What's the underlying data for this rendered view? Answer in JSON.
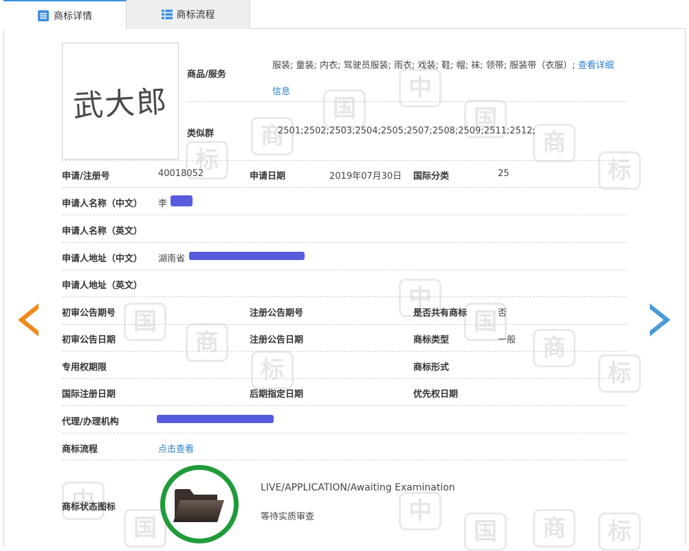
{
  "tabs": [
    {
      "label": "商标详情",
      "icon": "list-detail-icon",
      "active": true
    },
    {
      "label": "商标流程",
      "icon": "list-flow-icon",
      "active": false
    }
  ],
  "trademark": {
    "mark_text": "武大郎",
    "goods_label": "商品/服务",
    "goods_value": "服装; 童装; 内衣; 驾驶员服装; 雨衣; 戏装; 鞋; 帽; 袜; 领带; 服装带（衣服）;",
    "goods_more_link_1": "查看详细",
    "goods_more_link_2": "信息",
    "similar_label": "类似群",
    "similar_value": "2501;2502;2503;2504;2505;2507;2508;2509;2511;2512;"
  },
  "fields": {
    "reg_no_label": "申请/注册号",
    "reg_no": "40018052",
    "apply_date_label": "申请日期",
    "apply_date": "2019年07月30日",
    "intl_class_label": "国际分类",
    "intl_class": "25",
    "applicant_cn_label": "申请人名称（中文）",
    "applicant_cn": "李",
    "applicant_en_label": "申请人名称（英文）",
    "address_cn_label": "申请人地址（中文）",
    "address_cn": "湖南省",
    "address_en_label": "申请人地址（英文）",
    "prelim_no_label": "初审公告期号",
    "reg_pub_no_label": "注册公告期号",
    "shared_label": "是否共有商标",
    "shared": "否",
    "prelim_date_label": "初审公告日期",
    "reg_pub_date_label": "注册公告日期",
    "mark_type_label": "商标类型",
    "mark_type": "一般",
    "exclusive_label": "专用权期限",
    "mark_form_label": "商标形式",
    "intl_reg_date_label": "国际注册日期",
    "later_date_label": "后期指定日期",
    "priority_label": "优先权日期",
    "agent_label": "代理/办理机构",
    "flow_label": "商标流程",
    "flow_link": "点击查看",
    "status_icon_label": "商标状态图标",
    "status_en": "LIVE/APPLICATION/Awaiting Examination",
    "status_cn": "等待实质审查"
  },
  "watermark_chars": [
    "中",
    "国",
    "商",
    "标"
  ],
  "colors": {
    "accent": "#2a7fc9",
    "status_green": "#1f9b3a",
    "arrow_prev": "#f08a1b",
    "arrow_next": "#4a9ad8"
  }
}
